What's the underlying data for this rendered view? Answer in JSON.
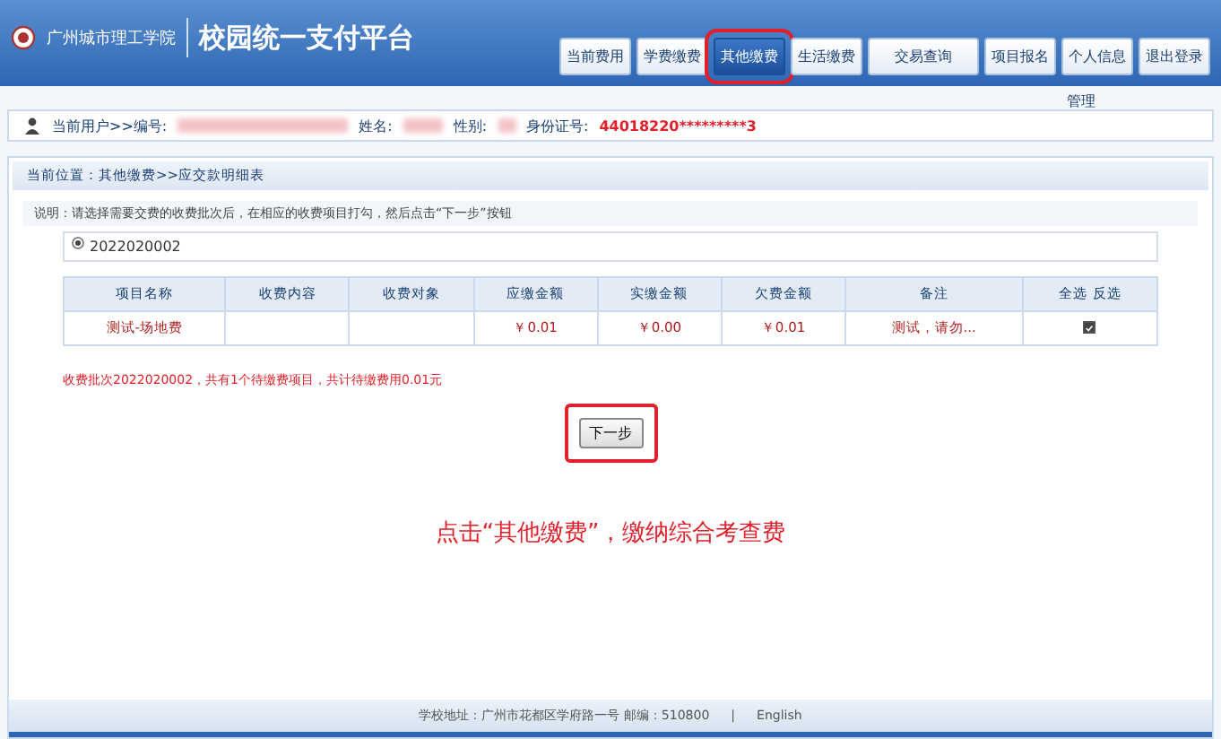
{
  "header": {
    "school": "广州城市理工学院",
    "title": "校园统一支付平台"
  },
  "tabs": [
    {
      "label": "当前费用",
      "selected": false,
      "highlighted": false
    },
    {
      "label": "学费缴费",
      "selected": false,
      "highlighted": false
    },
    {
      "label": "其他缴费",
      "selected": true,
      "highlighted": true
    },
    {
      "label": "生活缴费",
      "selected": false,
      "highlighted": false
    },
    {
      "label": "交易查询",
      "selected": false,
      "highlighted": false
    },
    {
      "label": "项目报名",
      "selected": false,
      "highlighted": false
    },
    {
      "label": "个人信息",
      "selected": false,
      "highlighted": false
    },
    {
      "label": "退出登录",
      "selected": false,
      "highlighted": false
    }
  ],
  "manage_link": "管理",
  "user_bar": {
    "current_user": "当前用户>>编号:",
    "name_label": "姓名:",
    "gender_label": "性别:",
    "id_label": "身份证号:",
    "id_value": "44018220*********3"
  },
  "breadcrumb": "当前位置：其他缴费>>应交款明细表",
  "instructions": "说明：请选择需要交费的收费批次后，在相应的收费项目打勾，然后点击“下一步”按钮",
  "batches": [
    {
      "label": "2022020002",
      "selected": true
    }
  ],
  "table": {
    "columns": [
      "项目名称",
      "收费内容",
      "收费对象",
      "应缴金额",
      "实缴金额",
      "欠费金额",
      "备注"
    ],
    "select_all": "全选",
    "invert": "反选",
    "rows": [
      {
        "cells": [
          "测试-场地费",
          "",
          "",
          "￥0.01",
          "￥0.00",
          "￥0.01",
          "测试，请勿..."
        ],
        "checked": true
      }
    ]
  },
  "summary": "收费批次2022020002，共有1个待缴费项目，共计待缴费用0.01元",
  "next_button": {
    "label": "下一步",
    "highlighted": true
  },
  "annotation": "点击“其他缴费”，缴纳综合考查费",
  "footer": {
    "address": "学校地址：广州市花都区学府路一号 邮编：510800",
    "separator": "|",
    "link": "English"
  }
}
